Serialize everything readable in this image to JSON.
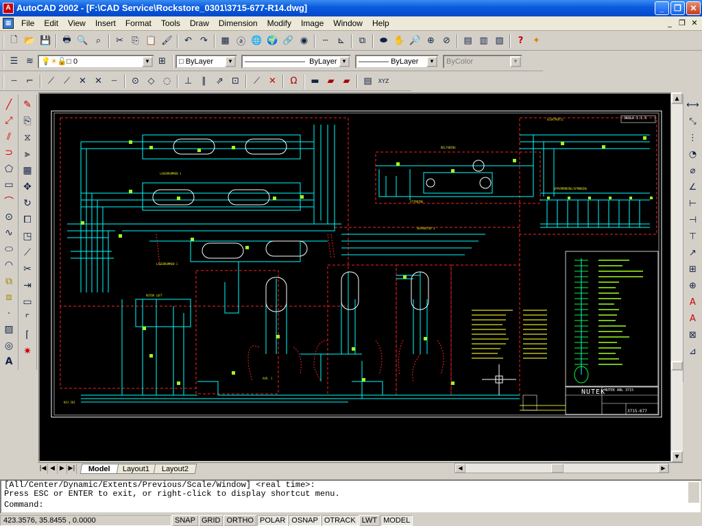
{
  "window": {
    "title": "AutoCAD 2002 - [F:\\CAD Service\\Rockstore_0301\\3715-677-R14.dwg]",
    "controls": [
      "minimize",
      "restore",
      "close"
    ]
  },
  "menu": {
    "items": [
      "File",
      "Edit",
      "View",
      "Insert",
      "Format",
      "Tools",
      "Draw",
      "Dimension",
      "Modify",
      "Image",
      "Window",
      "Help"
    ]
  },
  "layers_toolbar": {
    "layer_value": "0",
    "color_value": "ByLayer",
    "linetype_value": "ByLayer",
    "lineweight_value": "ByLayer",
    "plotstyle_value": "ByColor"
  },
  "drawing": {
    "title_block": {
      "company": "NUTEK",
      "project": "NUTEK ANL 3715",
      "drawing_number": "3715-677",
      "scale": "SKALA 1:1.5"
    },
    "labels": {
      "upper_room": "LAGERRUMMEN 1",
      "distributor": "BELYSNING",
      "heater_1": "ELEKTROFIL",
      "control": "STYRNING",
      "heater_block": "UPPVÄRMNING/SPÄNNING",
      "kaj": "KAJ 201",
      "mixer": "AVD. 1",
      "separator": "SEPARATOR 4",
      "dist_rooms": "LAGERRUMMEN 1",
      "roto": "ROTOR LUFT"
    }
  },
  "layouts": {
    "tabs": [
      "Model",
      "Layout1",
      "Layout2"
    ],
    "active": "Model"
  },
  "command": {
    "line1": "[All/Center/Dynamic/Extents/Previous/Scale/Window] <real time>:",
    "line2": "Press ESC or ENTER to exit, or right-click to display shortcut menu.",
    "prompt": "Command:"
  },
  "status": {
    "coordinates": "423.3576, 35.8455 , 0.0000",
    "toggles": [
      "SNAP",
      "GRID",
      "ORTHO",
      "POLAR",
      "OSNAP",
      "OTRACK",
      "LWT",
      "MODEL"
    ]
  }
}
